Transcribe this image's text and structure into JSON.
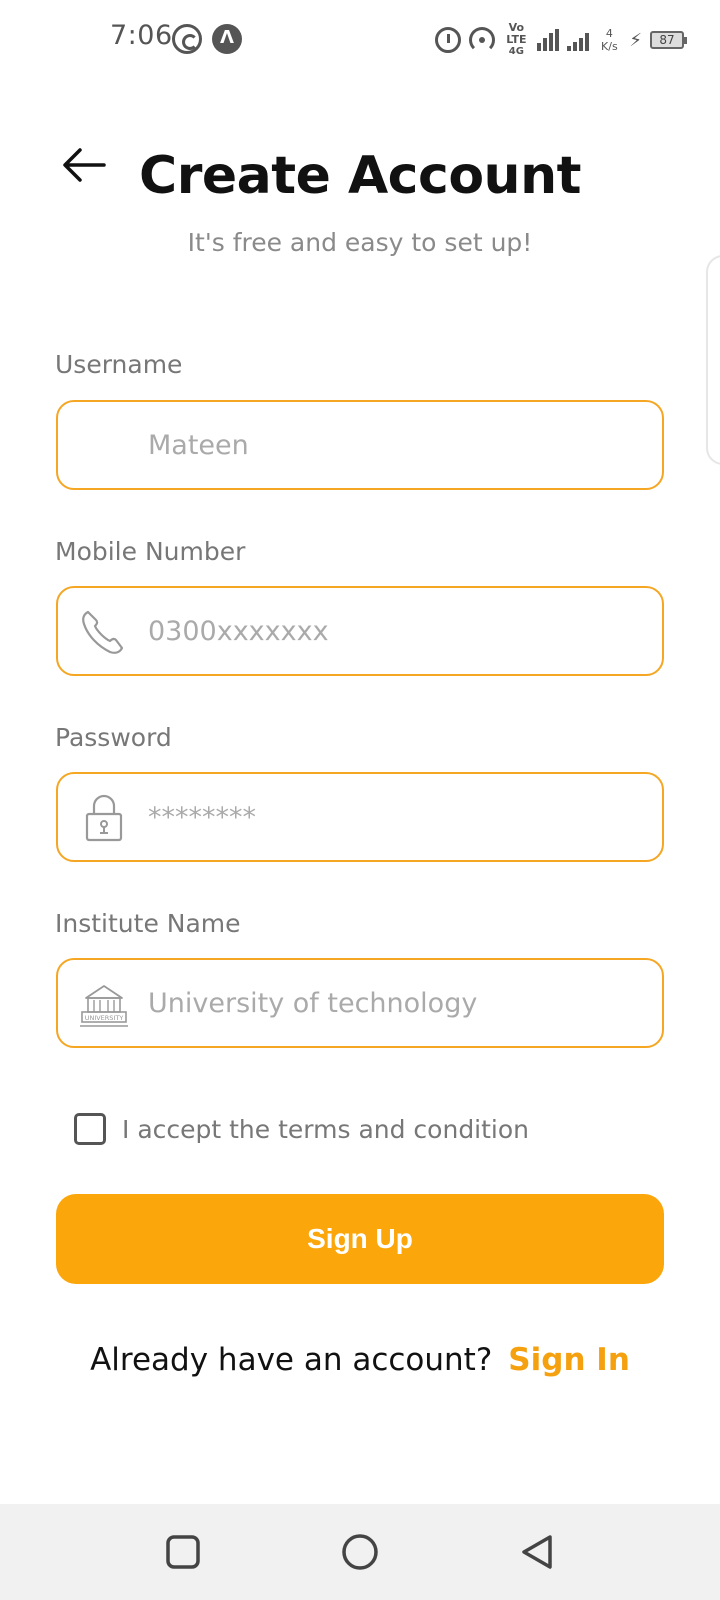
{
  "status_bar": {
    "time": "7:06",
    "network_label": "Vo LTE",
    "network_type": "4G",
    "speed_value": "4",
    "speed_unit": "K/s",
    "battery": "87"
  },
  "header": {
    "title": "Create Account",
    "subtitle": "It's free and easy to set up!"
  },
  "form": {
    "username": {
      "label": "Username",
      "placeholder": "Mateen"
    },
    "mobile": {
      "label": "Mobile Number",
      "placeholder": "0300xxxxxxx",
      "icon": "phone-icon"
    },
    "password": {
      "label": "Password",
      "placeholder": "********",
      "icon": "lock-icon"
    },
    "institute": {
      "label": "Institute Name",
      "placeholder": "University of technology",
      "icon": "university-icon",
      "icon_text": "UNIVERSITY"
    },
    "terms_label": "I accept the terms and condition",
    "terms_checked": false,
    "submit_label": "Sign Up"
  },
  "footer": {
    "prompt": "Already have an account?",
    "link_label": "Sign In"
  },
  "colors": {
    "accent": "#fba60b",
    "input_border": "#f5a623",
    "link": "#f5a10f"
  }
}
